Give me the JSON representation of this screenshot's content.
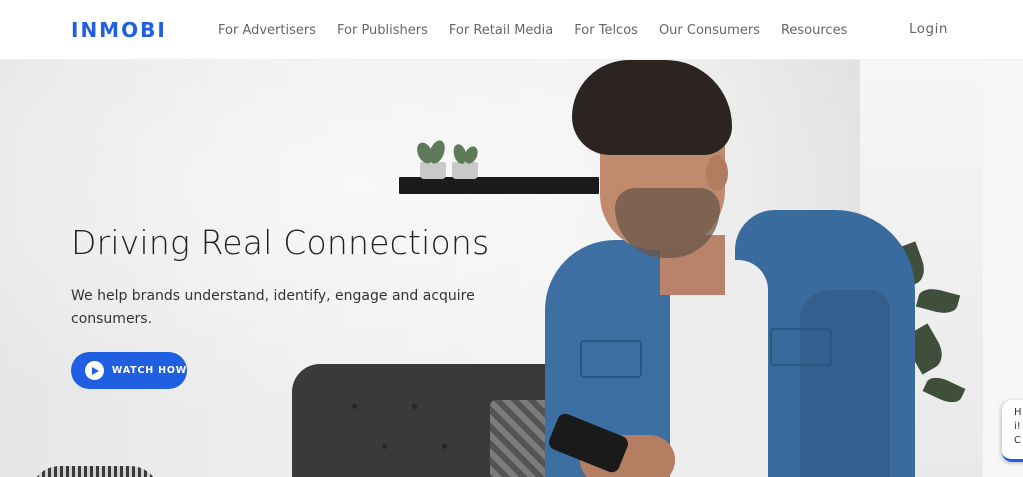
{
  "header": {
    "logo_text": "INMOBI",
    "nav": [
      {
        "label": "For Advertisers"
      },
      {
        "label": "For Publishers"
      },
      {
        "label": "For Retail Media"
      },
      {
        "label": "For Telcos"
      },
      {
        "label": "Our Consumers"
      },
      {
        "label": "Resources"
      }
    ],
    "login_label": "Login"
  },
  "hero": {
    "headline": "Driving Real Connections",
    "subtext": "We help brands understand, identify, engage and acquire consumers.",
    "cta_label": "WATCH HOW",
    "cta_icon": "play-icon"
  },
  "chat_widget": {
    "lines": [
      "H",
      "i!",
      "C"
    ]
  },
  "colors": {
    "brand": "#1f5fe0",
    "nav_text": "#666666",
    "headline": "#222222"
  }
}
